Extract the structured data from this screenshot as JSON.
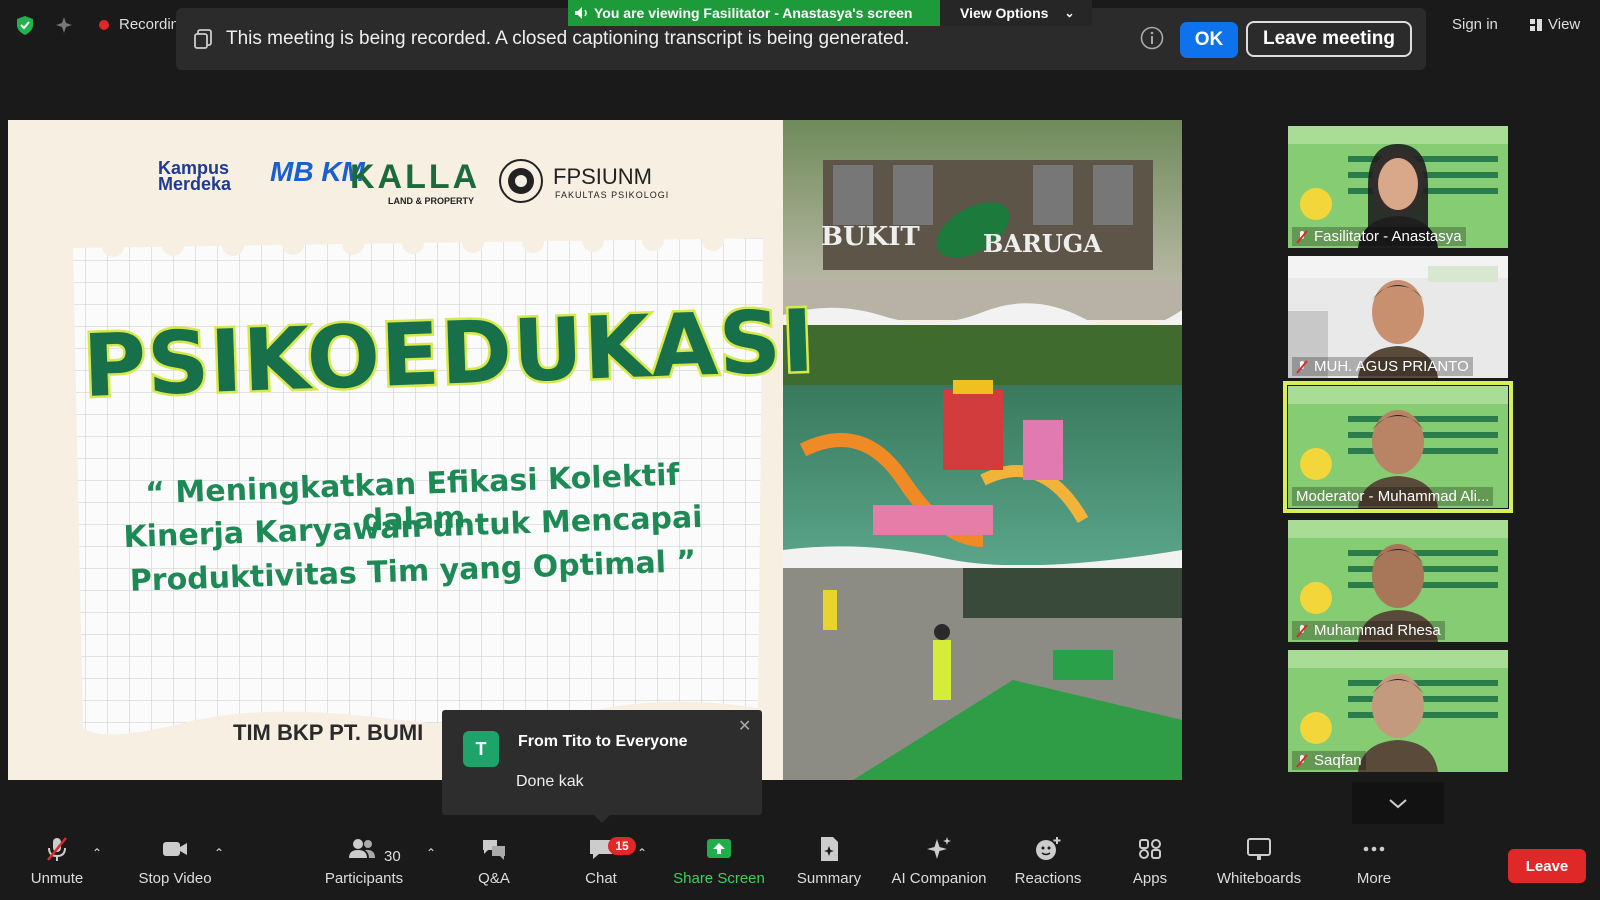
{
  "top_status": {
    "recording_label": "Recordin",
    "sign_in": "Sign in",
    "view": "View"
  },
  "viewing_banner": {
    "text": "You are viewing Fasilitator - Anastasya's screen",
    "options_label": "View Options"
  },
  "recording_notice": {
    "text": "This meeting is being recorded. A closed captioning transcript is being generated.",
    "ok_label": "OK",
    "leave_label": "Leave meeting"
  },
  "slide": {
    "logos": {
      "kampus_1": "Kampus",
      "kampus_2": "Merdeka",
      "mbkm": "MB KM",
      "kalla": "KALLA",
      "kalla_sub": "LAND & PROPERTY",
      "fpsi": "FPSIUNM",
      "fpsi_sub": "FAKULTAS PSIKOLOGI"
    },
    "title": "PSIKOEDUKASI",
    "subtitle_1": "“ Meningkatkan Efikasi Kolektif dalam",
    "subtitle_2": "Kinerja Karyawan untuk Mencapai",
    "subtitle_3": "Produktivitas Tim yang Optimal ”",
    "team": "TIM BKP PT. BUMI",
    "photo_sign_1": "BUKIT",
    "photo_sign_2": "BARUGA"
  },
  "participants": [
    {
      "name": "Fasilitator - Anastasya",
      "muted": true,
      "active": false
    },
    {
      "name": "MUH. AGUS PRIANTO",
      "muted": true,
      "active": false
    },
    {
      "name": "Moderator - Muhammad Ali...",
      "muted": false,
      "active": true
    },
    {
      "name": "Muhammad Rhesa",
      "muted": true,
      "active": false
    },
    {
      "name": "Saqfan",
      "muted": true,
      "active": false
    }
  ],
  "chat_toast": {
    "avatar_letter": "T",
    "title": "From Tito to Everyone",
    "message": "Done kak"
  },
  "toolbar": {
    "unmute": "Unmute",
    "stop_video": "Stop Video",
    "participants": "Participants",
    "participants_count": "30",
    "qa": "Q&A",
    "chat": "Chat",
    "chat_badge": "15",
    "share_screen": "Share Screen",
    "summary": "Summary",
    "ai_companion": "AI Companion",
    "reactions": "Reactions",
    "apps": "Apps",
    "whiteboards": "Whiteboards",
    "more": "More",
    "leave": "Leave"
  },
  "colors": {
    "accent_blue": "#0e72ed",
    "leave_red": "#e02828",
    "share_green": "#3ccf5c",
    "banner_green": "#1d9b3a",
    "active_speaker": "#d8f058"
  }
}
